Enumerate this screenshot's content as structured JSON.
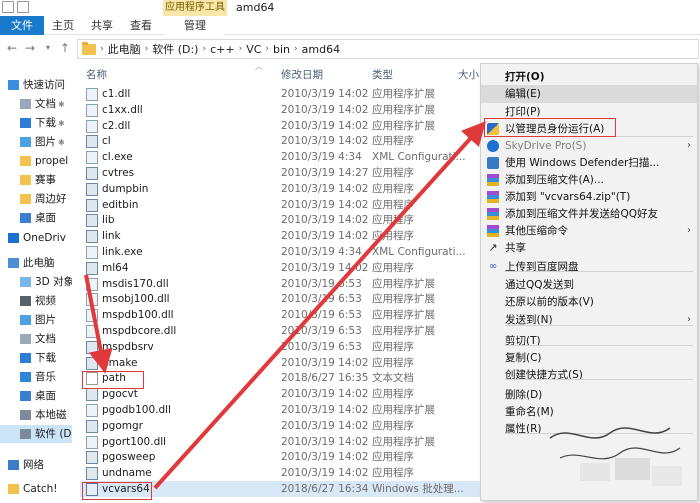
{
  "window": {
    "tools_title": "应用程序工具",
    "title": "amd64"
  },
  "tabs": {
    "file": "文件",
    "home": "主页",
    "share": "共享",
    "view": "查看",
    "manage": "管理"
  },
  "address": {
    "crumbs": [
      "此电脑",
      "软件 (D:)",
      "c++",
      "VC",
      "bin",
      "amd64"
    ]
  },
  "sidebar": {
    "items": [
      {
        "label": "快速访问",
        "icon": "star-icon"
      },
      {
        "label": "文档",
        "icon": "document-icon"
      },
      {
        "label": "下载",
        "icon": "download-icon"
      },
      {
        "label": "图片",
        "icon": "picture-icon"
      },
      {
        "label": "propel",
        "icon": "folder-icon"
      },
      {
        "label": "赛事",
        "icon": "folder-icon"
      },
      {
        "label": "周边好",
        "icon": "folder-icon"
      },
      {
        "label": "桌面",
        "icon": "desktop-icon"
      },
      {
        "label": "OneDriv",
        "icon": "cloud-icon"
      },
      {
        "label": "此电脑",
        "icon": "computer-icon"
      },
      {
        "label": "3D 对象",
        "icon": "cube-icon"
      },
      {
        "label": "视频",
        "icon": "video-icon"
      },
      {
        "label": "图片",
        "icon": "picture-icon"
      },
      {
        "label": "文档",
        "icon": "document-icon"
      },
      {
        "label": "下载",
        "icon": "download-icon"
      },
      {
        "label": "音乐",
        "icon": "music-icon"
      },
      {
        "label": "桌面",
        "icon": "desktop-icon"
      },
      {
        "label": "本地磁",
        "icon": "drive-icon"
      },
      {
        "label": "软件 (D",
        "icon": "drive-icon"
      },
      {
        "label": "网络",
        "icon": "network-icon"
      },
      {
        "label": "Catch!",
        "icon": "folder-icon"
      }
    ]
  },
  "list_header": {
    "name": "名称",
    "date": "修改日期",
    "type": "类型",
    "size": "大小"
  },
  "files": [
    {
      "name": "c1.dll",
      "date": "2010/3/19 14:02",
      "type": "应用程序扩展",
      "kind": "dll"
    },
    {
      "name": "c1xx.dll",
      "date": "2010/3/19 14:02",
      "type": "应用程序扩展",
      "kind": "dll"
    },
    {
      "name": "c2.dll",
      "date": "2010/3/19 14:02",
      "type": "应用程序扩展",
      "kind": "dll"
    },
    {
      "name": "cl",
      "date": "2010/3/19 14:02",
      "type": "应用程序",
      "kind": "exe"
    },
    {
      "name": "cl.exe",
      "date": "2010/3/19 4:34",
      "type": "XML Configurati...",
      "kind": "dll"
    },
    {
      "name": "cvtres",
      "date": "2010/3/19 14:27",
      "type": "应用程序",
      "kind": "exe"
    },
    {
      "name": "dumpbin",
      "date": "2010/3/19 14:02",
      "type": "应用程序",
      "kind": "exe"
    },
    {
      "name": "editbin",
      "date": "2010/3/19 14:02",
      "type": "应用程序",
      "kind": "exe"
    },
    {
      "name": "lib",
      "date": "2010/3/19 14:02",
      "type": "应用程序",
      "kind": "exe"
    },
    {
      "name": "link",
      "date": "2010/3/19 14:02",
      "type": "应用程序",
      "kind": "exe"
    },
    {
      "name": "link.exe",
      "date": "2010/3/19 4:34",
      "type": "XML Configurati...",
      "kind": "dll"
    },
    {
      "name": "ml64",
      "date": "2010/3/19 14:02",
      "type": "应用程序",
      "kind": "exe"
    },
    {
      "name": "msdis170.dll",
      "date": "2010/3/19 6:53",
      "type": "应用程序扩展",
      "kind": "dll"
    },
    {
      "name": "msobj100.dll",
      "date": "2010/3/19 6:53",
      "type": "应用程序扩展",
      "kind": "dll"
    },
    {
      "name": "mspdb100.dll",
      "date": "2010/3/19 6:53",
      "type": "应用程序扩展",
      "kind": "dll"
    },
    {
      "name": "mspdbcore.dll",
      "date": "2010/3/19 6:53",
      "type": "应用程序扩展",
      "kind": "dll"
    },
    {
      "name": "mspdbsrv",
      "date": "2010/3/19 6:53",
      "type": "应用程序",
      "kind": "exe"
    },
    {
      "name": "nmake",
      "date": "2010/3/19 14:02",
      "type": "应用程序",
      "kind": "exe"
    },
    {
      "name": "path",
      "date": "2018/6/27 16:35",
      "type": "文本文档",
      "kind": "txt"
    },
    {
      "name": "pgocvt",
      "date": "2010/3/19 14:02",
      "type": "应用程序",
      "kind": "exe"
    },
    {
      "name": "pgodb100.dll",
      "date": "2010/3/19 14:02",
      "type": "应用程序扩展",
      "kind": "dll"
    },
    {
      "name": "pgomgr",
      "date": "2010/3/19 14:02",
      "type": "应用程序",
      "kind": "exe"
    },
    {
      "name": "pgort100.dll",
      "date": "2010/3/19 14:02",
      "type": "应用程序扩展",
      "kind": "dll"
    },
    {
      "name": "pgosweep",
      "date": "2010/3/19 14:02",
      "type": "应用程序",
      "kind": "exe"
    },
    {
      "name": "undname",
      "date": "2010/3/19 14:02",
      "type": "应用程序",
      "kind": "exe"
    },
    {
      "name": "vcvars64",
      "date": "2018/6/27 16:34",
      "type": "Windows 批处理...",
      "kind": "bat"
    }
  ],
  "context_menu": {
    "items": [
      {
        "label": "打开(O)",
        "bold": true
      },
      {
        "label": "编辑(E)",
        "hover": true
      },
      {
        "label": "打印(P)"
      },
      {
        "label": "以管理员身份运行(A)",
        "icon": "shield-icon"
      },
      {
        "label": "SkyDrive Pro(S)",
        "icon": "skydrive-icon",
        "disabled": true,
        "submenu": true
      },
      {
        "label": "使用 Windows Defender扫描...",
        "icon": "defender-icon"
      },
      {
        "label": "添加到压缩文件(A)...",
        "icon": "archive-icon"
      },
      {
        "label": "添加到 \"vcvars64.zip\"(T)",
        "icon": "archive-icon"
      },
      {
        "label": "添加到压缩文件并发送给QQ好友",
        "icon": "archive-icon"
      },
      {
        "label": "其他压缩命令",
        "icon": "archive-icon",
        "submenu": true
      },
      {
        "label": "共享",
        "icon": "share-icon"
      },
      {
        "label": "上传到百度网盘",
        "icon": "baidu-icon"
      },
      {
        "label": "通过QQ发送到"
      },
      {
        "label": "还原以前的版本(V)"
      },
      {
        "label": "发送到(N)",
        "submenu": true
      },
      {
        "label": "剪切(T)"
      },
      {
        "label": "复制(C)"
      },
      {
        "label": "创建快捷方式(S)"
      },
      {
        "label": "删除(D)"
      },
      {
        "label": "重命名(M)"
      },
      {
        "label": "属性(R)"
      }
    ]
  },
  "colors": {
    "accent": "#1979ca",
    "highlight_red": "#e0393b",
    "tools_tab": "#f8e7a8"
  }
}
